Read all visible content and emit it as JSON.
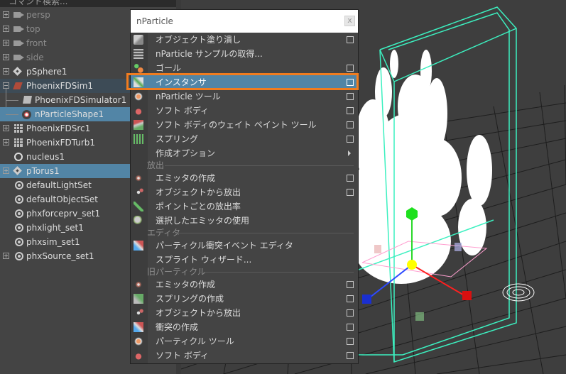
{
  "outliner": {
    "search_placeholder": "コマンド検索...",
    "items": [
      {
        "label": "persp",
        "icon": "camera-icon",
        "dim": true
      },
      {
        "label": "top",
        "icon": "camera-icon",
        "dim": true
      },
      {
        "label": "front",
        "icon": "camera-icon",
        "dim": true
      },
      {
        "label": "side",
        "icon": "camera-icon",
        "dim": true
      },
      {
        "label": "pSphere1",
        "icon": "transform-icon"
      },
      {
        "label": "PhoenixFDSim1",
        "icon": "phoenix-sim-icon",
        "selected": true
      },
      {
        "label": "PhoenixFDSimulator1",
        "icon": "phoenix-simulator-icon"
      },
      {
        "label": "nParticleShape1",
        "icon": "nparticle-shape-icon",
        "selected": true
      },
      {
        "label": "PhoenixFDSrc1",
        "icon": "grid-icon"
      },
      {
        "label": "PhoenixFDTurb1",
        "icon": "grid-icon"
      },
      {
        "label": "nucleus1",
        "icon": "nucleus-icon"
      },
      {
        "label": "pTorus1",
        "icon": "transform-icon",
        "selected": true
      },
      {
        "label": "defaultLightSet",
        "icon": "set-icon"
      },
      {
        "label": "defaultObjectSet",
        "icon": "set-icon"
      },
      {
        "label": "phxforceprv_set1",
        "icon": "set-icon"
      },
      {
        "label": "phxlight_set1",
        "icon": "set-icon"
      },
      {
        "label": "phxsim_set1",
        "icon": "set-icon"
      },
      {
        "label": "phxSource_set1",
        "icon": "set-icon"
      }
    ]
  },
  "menu": {
    "title": "nParticle",
    "close_label": "x",
    "items": [
      {
        "label": "オブジェクト塗り潰し",
        "icon": "fill-object-icon",
        "option_box": true
      },
      {
        "label": "nParticle サンプルの取得...",
        "icon": "sample-icon"
      },
      {
        "label": "ゴール",
        "icon": "goal-icon",
        "option_box": true
      },
      {
        "label": "インスタンサ",
        "icon": "instancer-icon",
        "option_box": true,
        "highlighted": true
      },
      {
        "label": "nParticle ツール",
        "icon": "nparticle-tool-icon",
        "option_box": true
      },
      {
        "label": "ソフト ボディ",
        "icon": "soft-body-icon",
        "option_box": true
      },
      {
        "label": "ソフト ボディのウェイト ペイント ツール",
        "icon": "paint-weights-icon",
        "option_box": true
      },
      {
        "label": "スプリング",
        "icon": "springs-icon",
        "option_box": true
      },
      {
        "label": "作成オプション",
        "icon": "",
        "submenu": true
      }
    ],
    "sections": [
      {
        "title": "放出",
        "items": [
          {
            "label": "エミッタの作成",
            "icon": "create-emitter-icon",
            "option_box": true
          },
          {
            "label": "オブジェクトから放出",
            "icon": "emit-from-object-icon",
            "option_box": true
          },
          {
            "label": "ポイントごとの放出率",
            "icon": "per-point-rate-icon"
          },
          {
            "label": "選択したエミッタの使用",
            "icon": "use-emitter-icon"
          }
        ]
      },
      {
        "title": "エディタ",
        "items": [
          {
            "label": "パーティクル衝突イベント エディタ",
            "icon": "collision-editor-icon"
          },
          {
            "label": "スプライト ウィザード...",
            "icon": ""
          }
        ]
      },
      {
        "title": "旧パーティクル",
        "items": [
          {
            "label": "エミッタの作成",
            "icon": "legacy-emitter-icon",
            "option_box": true
          },
          {
            "label": "スプリングの作成",
            "icon": "legacy-springs-icon",
            "option_box": true
          },
          {
            "label": "オブジェクトから放出",
            "icon": "legacy-emit-icon",
            "option_box": true
          },
          {
            "label": "衝突の作成",
            "icon": "make-collide-icon",
            "option_box": true
          },
          {
            "label": "パーティクル ツール",
            "icon": "particle-tool-icon",
            "option_box": true
          },
          {
            "label": "ソフト ボディ",
            "icon": "legacy-soft-body-icon",
            "option_box": true
          }
        ]
      }
    ]
  },
  "colors": {
    "selection": "#5285a6",
    "highlight_outline": "#f07c1f",
    "wireframe": "#3cf0c0"
  }
}
